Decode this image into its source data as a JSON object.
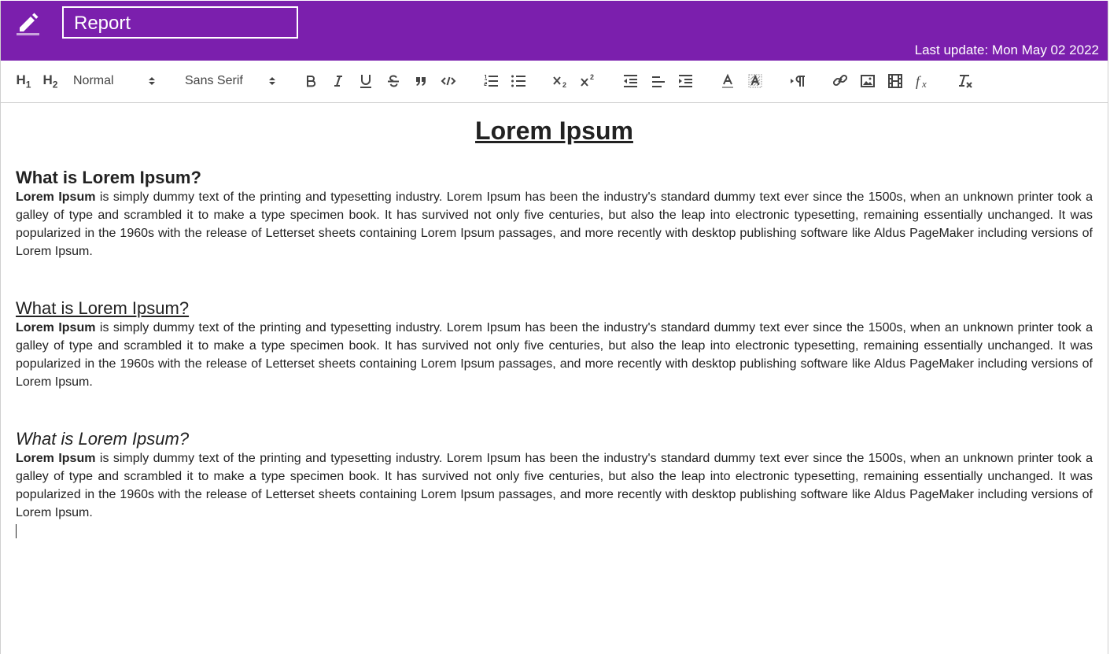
{
  "header": {
    "title": "Report",
    "last_update": "Last update: Mon May 02 2022",
    "edit_icon": "pencil-icon",
    "bg_color": "#7b1fad"
  },
  "toolbar": {
    "h1_label": "H",
    "h1_sub": "1",
    "h2_label": "H",
    "h2_sub": "2",
    "size_select": "Normal",
    "font_select": "Sans Serif",
    "icons": [
      "bold-icon",
      "italic-icon",
      "underline-icon",
      "strike-icon",
      "blockquote-icon",
      "code-icon",
      "ordered-list-icon",
      "bullet-list-icon",
      "subscript-icon",
      "superscript-icon",
      "outdent-icon",
      "align-icon",
      "indent-icon",
      "font-color-icon",
      "background-color-icon",
      "text-direction-icon",
      "link-icon",
      "image-icon",
      "video-icon",
      "formula-icon",
      "clear-format-icon"
    ]
  },
  "document": {
    "title": "Lorem Ipsum",
    "sections": [
      {
        "heading": "What is Lorem Ipsum?",
        "lead": "Lorem Ipsum",
        "body": " is simply dummy text of the printing and typesetting industry. Lorem Ipsum has been the industry's standard dummy text ever since the 1500s, when an unknown printer took a galley of type and scrambled it to make a type specimen book. It has survived not only five centuries, but also the leap into electronic typesetting, remaining essentially unchanged. It was popularized in the 1960s with the release of Letterset sheets containing Lorem Ipsum passages, and more recently with desktop publishing software like Aldus PageMaker including versions of Lorem Ipsum."
      },
      {
        "heading": "What is Lorem Ipsum?",
        "lead": "Lorem Ipsum",
        "body": " is simply dummy text of the printing and typesetting industry. Lorem Ipsum has been the industry's standard dummy text ever since the 1500s, when an unknown printer took a galley of type and scrambled it to make a type specimen book. It has survived not only five centuries, but also the leap into electronic typesetting, remaining essentially unchanged. It was popularized in the 1960s with the release of Letterset sheets containing Lorem Ipsum passages, and more recently with desktop publishing software like Aldus PageMaker including versions of Lorem Ipsum."
      },
      {
        "heading": "What is Lorem Ipsum?",
        "lead": "Lorem Ipsum",
        "body": " is simply dummy text of the printing and typesetting industry. Lorem Ipsum has been the industry's standard dummy text ever since the 1500s, when an unknown printer took a galley of type and scrambled it to make a type specimen book. It has survived not only five centuries, but also the leap into electronic typesetting, remaining essentially unchanged. It was popularized in the 1960s with the release of Letterset sheets containing Lorem Ipsum passages, and more recently with desktop publishing software like Aldus PageMaker including versions of Lorem Ipsum."
      }
    ]
  }
}
